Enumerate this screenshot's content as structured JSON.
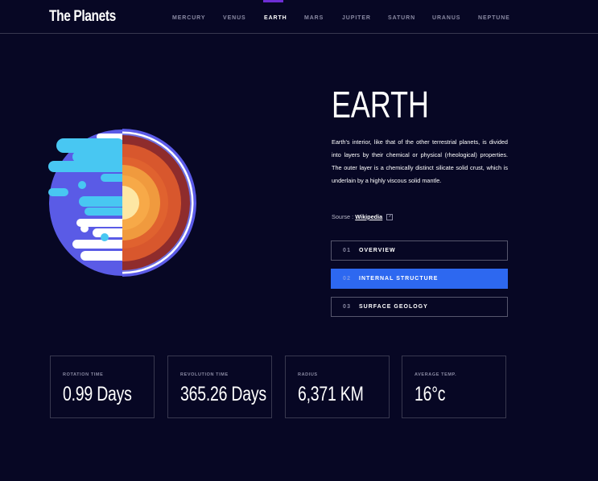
{
  "header": {
    "logo": "The Planets",
    "nav": [
      "MERCURY",
      "VENUS",
      "EARTH",
      "MARS",
      "JUPITER",
      "SATURN",
      "URANUS",
      "NEPTUNE"
    ],
    "active": "EARTH"
  },
  "planet": {
    "name": "EARTH",
    "description": "Earth's interior, like that of the other terrestrial planets, is divided into layers by their chemical or physical (rheological) properties. The outer layer is a chemically distinct silicate solid crust, which is underlain by a highly viscous solid mantle.",
    "source_label": "Sourse :",
    "source_link": "Wikipedia",
    "image": "earth-internal-structure-icon"
  },
  "tabs": [
    {
      "num": "01",
      "label": "OVERVIEW"
    },
    {
      "num": "02",
      "label": "INTERNAL STRUCTURE"
    },
    {
      "num": "03",
      "label": "SURFACE GEOLOGY"
    }
  ],
  "active_tab": "INTERNAL STRUCTURE",
  "stats": [
    {
      "label": "ROTATION TIME",
      "value": "0.99 Days"
    },
    {
      "label": "REVOLUTION TIME",
      "value": "365.26 Days"
    },
    {
      "label": "RADIUS",
      "value": "6,371 KM"
    },
    {
      "label": "AVERAGE TEMP.",
      "value": "16°c"
    }
  ],
  "colors": {
    "background": "#070724",
    "accent_tab": "#2d68f0",
    "border": "#38384f"
  }
}
